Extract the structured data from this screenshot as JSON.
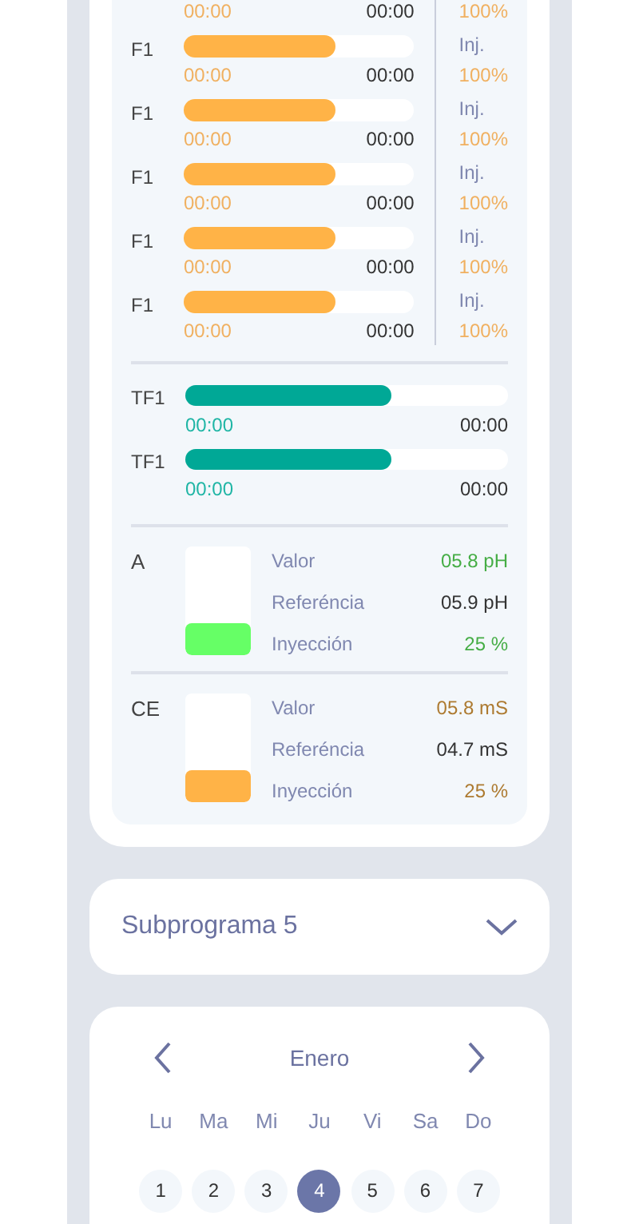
{
  "injections": [
    {
      "start": "00:00",
      "end": "00:00",
      "pct": "100%"
    },
    {
      "label": "F1",
      "level": 0.66,
      "start": "00:00",
      "end": "00:00",
      "tag": "Inj.",
      "pct": "100%"
    },
    {
      "label": "F1",
      "level": 0.66,
      "start": "00:00",
      "end": "00:00",
      "tag": "Inj.",
      "pct": "100%"
    },
    {
      "label": "F1",
      "level": 0.66,
      "start": "00:00",
      "end": "00:00",
      "tag": "Inj.",
      "pct": "100%"
    },
    {
      "label": "F1",
      "level": 0.66,
      "start": "00:00",
      "end": "00:00",
      "tag": "Inj.",
      "pct": "100%"
    },
    {
      "label": "F1",
      "level": 0.66,
      "start": "00:00",
      "end": "00:00",
      "tag": "Inj.",
      "pct": "100%"
    }
  ],
  "timers": [
    {
      "label": "TF1",
      "level": 0.64,
      "start": "00:00",
      "end": "00:00"
    },
    {
      "label": "TF1",
      "level": 0.64,
      "start": "00:00",
      "end": "00:00"
    }
  ],
  "sensors": [
    {
      "label": "A",
      "color": "#66ff66",
      "level": 0.3,
      "rows": [
        {
          "label": "Valor",
          "value": "05.8 pH",
          "accent": true
        },
        {
          "label": "Referéncia",
          "value": "05.9 pH",
          "accent": false
        },
        {
          "label": "Inyección",
          "value": "25 %",
          "accent": true
        }
      ]
    },
    {
      "label": "CE",
      "color": "#ffb347",
      "level": 0.3,
      "rows": [
        {
          "label": "Valor",
          "value": "05.8 mS",
          "accent": true
        },
        {
          "label": "Referéncia",
          "value": "04.7 mS",
          "accent": false
        },
        {
          "label": "Inyección",
          "value": "25 %",
          "accent": true
        }
      ]
    }
  ],
  "subprogram": {
    "label": "Subprograma 5"
  },
  "calendar": {
    "month": "Enero",
    "weekdays": [
      "Lu",
      "Ma",
      "Mi",
      "Ju",
      "Vi",
      "Sa",
      "Do"
    ],
    "days": [
      {
        "label": "1",
        "selected": false
      },
      {
        "label": "2",
        "selected": false
      },
      {
        "label": "3",
        "selected": false
      },
      {
        "label": "4",
        "selected": true
      },
      {
        "label": "5",
        "selected": false
      },
      {
        "label": "6",
        "selected": false
      },
      {
        "label": "7",
        "selected": false
      }
    ]
  }
}
